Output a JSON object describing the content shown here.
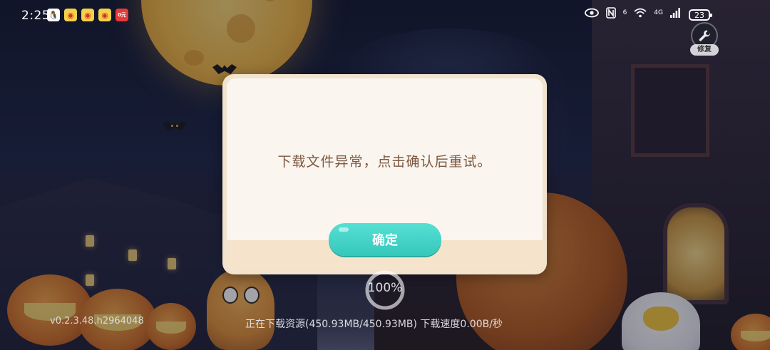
{
  "status_bar": {
    "time": "2:25",
    "apps": [
      {
        "icon": "qq-icon",
        "glyph": "🐧"
      },
      {
        "icon": "weibo-icon",
        "glyph": "◉"
      },
      {
        "icon": "weibo-icon",
        "glyph": "◉"
      },
      {
        "icon": "weibo-icon",
        "glyph": "◉"
      },
      {
        "icon": "app-red-icon",
        "glyph": "0元"
      }
    ],
    "network_6": "6",
    "network_4g": "4G",
    "battery": "23"
  },
  "repair": {
    "label": "修复",
    "icon": "wrench-icon"
  },
  "dialog": {
    "message": "下载文件异常，点击确认后重试。",
    "confirm_label": "确定"
  },
  "loading": {
    "progress_text": "100%",
    "progress_value": 1.0,
    "version": "v0.2.3.48.h2964048",
    "download_status": "正在下载资源(450.93MB/450.93MB) 下载速度0.00B/秒"
  },
  "colors": {
    "dialog_border": "#f2e3cf",
    "dialog_bg": "#faf5ee",
    "message_text": "#7b5740",
    "confirm_button": "#3ccfc2"
  }
}
